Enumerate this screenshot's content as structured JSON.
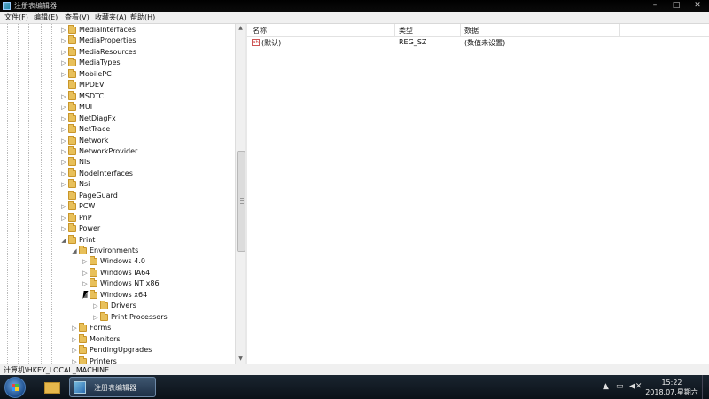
{
  "window": {
    "title": "注册表编辑器",
    "minimize": "–",
    "maximize": "□",
    "close": "✕"
  },
  "menu": [
    "文件(F)",
    "编辑(E)",
    "查看(V)",
    "收藏夹(A)",
    "帮助(H)"
  ],
  "tree": {
    "items": [
      {
        "label": "MediaInterfaces",
        "expander": "▷"
      },
      {
        "label": "MediaProperties",
        "expander": "▷"
      },
      {
        "label": "MediaResources",
        "expander": "▷"
      },
      {
        "label": "MediaTypes",
        "expander": "▷"
      },
      {
        "label": "MobilePC",
        "expander": "▷"
      },
      {
        "label": "MPDEV",
        "expander": ""
      },
      {
        "label": "MSDTC",
        "expander": "▷"
      },
      {
        "label": "MUI",
        "expander": "▷"
      },
      {
        "label": "NetDiagFx",
        "expander": "▷"
      },
      {
        "label": "NetTrace",
        "expander": "▷"
      },
      {
        "label": "Network",
        "expander": "▷"
      },
      {
        "label": "NetworkProvider",
        "expander": "▷"
      },
      {
        "label": "Nls",
        "expander": "▷"
      },
      {
        "label": "NodeInterfaces",
        "expander": "▷"
      },
      {
        "label": "Nsi",
        "expander": "▷"
      },
      {
        "label": "PageGuard",
        "expander": ""
      },
      {
        "label": "PCW",
        "expander": "▷"
      },
      {
        "label": "PnP",
        "expander": "▷"
      },
      {
        "label": "Power",
        "expander": "▷"
      },
      {
        "label": "Print",
        "expander": "◢"
      },
      {
        "label": "Environments",
        "expander": "◢"
      },
      {
        "label": "Windows 4.0",
        "expander": "▷"
      },
      {
        "label": "Windows IA64",
        "expander": "▷"
      },
      {
        "label": "Windows NT x86",
        "expander": "▷"
      },
      {
        "label": "Windows x64",
        "expander": "◢"
      },
      {
        "label": "Drivers",
        "expander": "▷"
      },
      {
        "label": "Print Processors",
        "expander": "▷"
      },
      {
        "label": "Forms",
        "expander": "▷"
      },
      {
        "label": "Monitors",
        "expander": "▷"
      },
      {
        "label": "PendingUpgrades",
        "expander": "▷"
      },
      {
        "label": "Printers",
        "expander": "▷"
      }
    ]
  },
  "list": {
    "columns": [
      "名称",
      "类型",
      "数据"
    ],
    "rows": [
      {
        "name": "(默认)",
        "type": "REG_SZ",
        "data": "(数值未设置)",
        "icon": "ab"
      }
    ]
  },
  "status": "计算机\\HKEY_LOCAL_MACHINE",
  "taskbar": {
    "regedit_label": "注册表编辑器",
    "time": "15:22",
    "date": "2018.07.星期六"
  }
}
